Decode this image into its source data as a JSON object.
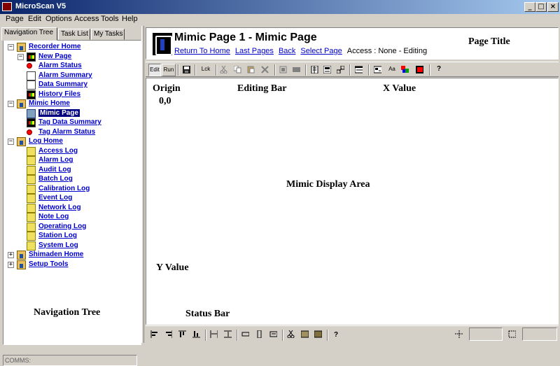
{
  "window": {
    "title": "MicroScan V5"
  },
  "menu": [
    "Page",
    "Edit",
    "Options",
    "Access",
    "Tools",
    "Help"
  ],
  "nav": {
    "tabs": [
      "Navigation Tree",
      "Task List",
      "My Tasks"
    ],
    "tree": [
      {
        "label": "Recorder Home",
        "icon": "house-icon",
        "expander": "−"
      },
      {
        "label": "New Page",
        "icon": "chart-icon",
        "expander": "−"
      },
      {
        "label": "Alarm Status",
        "icon": "alarm-icon"
      },
      {
        "label": "Alarm Summary",
        "icon": "document-icon"
      },
      {
        "label": "Data Summary",
        "icon": "document-icon"
      },
      {
        "label": "History Files",
        "icon": "chart-icon"
      },
      {
        "label": "Mimic Home",
        "icon": "house-icon",
        "expander": "−"
      },
      {
        "label": "Mimic Page",
        "icon": "mimic-icon",
        "selected": true
      },
      {
        "label": "Tag Data Summary",
        "icon": "chart-icon"
      },
      {
        "label": "Tag Alarm Status",
        "icon": "alarm-icon"
      },
      {
        "label": "Log Home",
        "icon": "house-icon",
        "expander": "−"
      },
      {
        "label": "Access Log",
        "icon": "folder-icon"
      },
      {
        "label": "Alarm Log",
        "icon": "folder-icon"
      },
      {
        "label": "Audit Log",
        "icon": "folder-icon"
      },
      {
        "label": "Batch Log",
        "icon": "folder-icon"
      },
      {
        "label": "Calibration Log",
        "icon": "folder-icon"
      },
      {
        "label": "Event Log",
        "icon": "folder-icon"
      },
      {
        "label": "Network Log",
        "icon": "folder-icon"
      },
      {
        "label": "Note Log",
        "icon": "folder-icon"
      },
      {
        "label": "Operating Log",
        "icon": "folder-icon"
      },
      {
        "label": "Station Log",
        "icon": "folder-icon"
      },
      {
        "label": "System Log",
        "icon": "folder-icon"
      },
      {
        "label": "Shimaden Home",
        "icon": "house-icon",
        "expander": "+"
      },
      {
        "label": "Setup Tools",
        "icon": "house-icon",
        "expander": "+"
      }
    ],
    "comms_label": "COMMS:"
  },
  "header": {
    "title": "Mimic Page 1 - Mimic Page",
    "links": [
      "Return To Home",
      "Last Pages",
      "Back",
      "Select Page"
    ],
    "access": "Access : None - Editing"
  },
  "toolbar": {
    "edit": "Edit",
    "run": "Run",
    "lock": "Lck",
    "text_size": "Aa",
    "help": "?"
  },
  "statusbar": {
    "help": "?"
  },
  "annotations": {
    "page_title": "Page Title",
    "origin": "Origin",
    "origin_value": "0,0",
    "editing_bar": "Editing Bar",
    "x_value": "X Value",
    "mimic_display_area": "Mimic Display Area",
    "y_value": "Y Value",
    "status_bar": "Status Bar",
    "navigation_tree": "Navigation Tree"
  }
}
